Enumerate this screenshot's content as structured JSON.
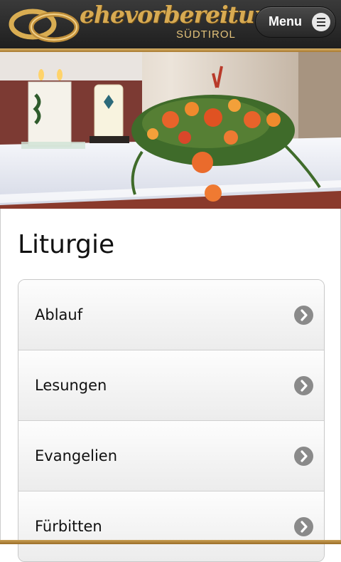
{
  "header": {
    "logo_text": "ehevorbereitung",
    "logo_subtitle": "SÜDTIROL",
    "menu_label": "Menu",
    "menu_icon": "hamburger-icon",
    "accent_color": "#d7aa52"
  },
  "hero": {
    "icons": [
      "candle-icon",
      "candle-icon",
      "flower-arrangement-icon"
    ]
  },
  "main": {
    "title": "Liturgie",
    "items": [
      {
        "label": "Ablauf",
        "icon": "chevron-right-icon"
      },
      {
        "label": "Lesungen",
        "icon": "chevron-right-icon"
      },
      {
        "label": "Evangelien",
        "icon": "chevron-right-icon"
      },
      {
        "label": "Fürbitten",
        "icon": "chevron-right-icon"
      }
    ]
  }
}
